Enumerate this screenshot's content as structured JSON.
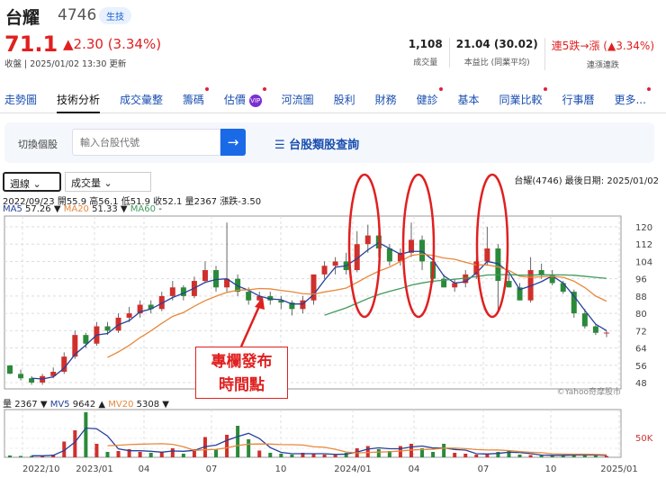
{
  "header": {
    "name": "台耀",
    "code": "4746",
    "tag": "生技",
    "price": "71.1",
    "change": "▲2.30 (3.34%)",
    "updated": "收盤 | 2025/01/02 13:30 更新"
  },
  "stats": [
    {
      "value": "1,108",
      "label": "成交量"
    },
    {
      "value": "21.04 (30.02)",
      "label": "本益比 (同業平均)"
    },
    {
      "value": "連5跌→漲 (▲3.34%)",
      "label": "連漲連跌"
    }
  ],
  "nav": [
    {
      "label": "走勢圖"
    },
    {
      "label": "技術分析",
      "active": true
    },
    {
      "label": "成交彙整"
    },
    {
      "label": "籌碼",
      "dot": true
    },
    {
      "label": "估價",
      "vip": "VIP",
      "dot": true
    },
    {
      "label": "河流圖"
    },
    {
      "label": "股利"
    },
    {
      "label": "財務"
    },
    {
      "label": "健診",
      "dot": true
    },
    {
      "label": "基本"
    },
    {
      "label": "同業比較",
      "dot": true
    },
    {
      "label": "行事曆"
    },
    {
      "label": "更多...",
      "dot": true
    }
  ],
  "search": {
    "label": "切換個股",
    "placeholder": "輸入台股代號",
    "arrow": "→",
    "category": "☰ 台股類股查詢"
  },
  "controls": {
    "period": "週線 ⌄",
    "indicator": "成交量 ⌄",
    "symbol": "台耀(4746)  最後日期: 2025/01/02"
  },
  "legend": {
    "ohlc": "2022/09/23 開55.9 高56.1 低51.9 收52.1 量2367 漲跌-3.50",
    "ma5": "MA5",
    "ma5v": "57.26 ▼",
    "ma20": "MA20",
    "ma20v": "51.33 ▼",
    "ma60": "MA60",
    "ma60v": "-",
    "vol": "量",
    "volv": "2367 ▼",
    "mv5": "MV5",
    "mv5v": "9642 ▲",
    "mv20": "MV20",
    "mv20v": "5308 ▼"
  },
  "annotation": {
    "line1": "專欄發布",
    "line2": "時間點"
  },
  "watermark": "©Yahoo奇摩股市",
  "colors": {
    "up": "#d0302c",
    "down": "#2a8a3a",
    "ma5": "#25409a",
    "ma20": "#e8883a",
    "ma60": "#3f9a5a",
    "accent": "#e02020"
  },
  "chart_data": {
    "type": "candlestick",
    "yticks": [
      120,
      112,
      104,
      96,
      88,
      80,
      72,
      64,
      56,
      48
    ],
    "ylim": [
      44,
      124
    ],
    "xticks": [
      "2022/10",
      "2023/01",
      "04",
      "07",
      "10",
      "2024/01",
      "04",
      "07",
      "10",
      "2025/01"
    ],
    "vol_tick": "50K",
    "candles": [
      [
        55.9,
        56.1,
        51.9,
        52.1,
        4
      ],
      [
        52,
        54,
        49,
        50,
        3
      ],
      [
        50,
        51,
        47,
        48,
        3
      ],
      [
        48,
        52,
        47,
        51,
        4
      ],
      [
        51,
        55,
        50,
        53,
        6
      ],
      [
        53,
        62,
        52,
        60,
        35
      ],
      [
        60,
        72,
        59,
        70,
        60
      ],
      [
        70,
        71,
        64,
        66,
        100
      ],
      [
        66,
        76,
        65,
        74,
        30
      ],
      [
        74,
        76,
        70,
        72,
        12
      ],
      [
        72,
        80,
        71,
        78,
        14
      ],
      [
        78,
        83,
        76,
        80,
        18
      ],
      [
        80,
        86,
        78,
        84,
        12
      ],
      [
        84,
        86,
        80,
        82,
        10
      ],
      [
        82,
        90,
        81,
        88,
        12
      ],
      [
        88,
        95,
        86,
        92,
        20
      ],
      [
        92,
        93,
        86,
        88,
        8
      ],
      [
        88,
        97,
        87,
        95,
        18
      ],
      [
        95,
        104,
        94,
        100,
        45
      ],
      [
        100,
        102,
        90,
        92,
        18
      ],
      [
        92,
        122,
        90,
        96,
        50
      ],
      [
        96,
        98,
        88,
        90,
        70
      ],
      [
        90,
        92,
        84,
        86,
        40
      ],
      [
        86,
        90,
        84,
        88,
        15
      ],
      [
        88,
        90,
        84,
        86,
        10
      ],
      [
        86,
        88,
        82,
        85,
        8
      ],
      [
        85,
        86,
        79,
        82,
        6
      ],
      [
        82,
        88,
        80,
        86,
        10
      ],
      [
        86,
        96,
        84,
        98,
        8
      ],
      [
        98,
        104,
        96,
        102,
        6
      ],
      [
        102,
        106,
        98,
        104,
        5
      ],
      [
        104,
        108,
        98,
        100,
        10
      ],
      [
        100,
        118,
        99,
        112,
        20
      ],
      [
        112,
        121,
        108,
        116,
        25
      ],
      [
        116,
        118,
        106,
        110,
        18
      ],
      [
        110,
        112,
        102,
        104,
        14
      ],
      [
        104,
        110,
        102,
        108,
        25
      ],
      [
        108,
        122,
        106,
        114,
        30
      ],
      [
        114,
        116,
        100,
        104,
        20
      ],
      [
        104,
        106,
        94,
        96,
        12
      ],
      [
        96,
        98,
        92,
        92,
        30
      ],
      [
        92,
        96,
        90,
        94,
        10
      ],
      [
        94,
        100,
        92,
        98,
        8
      ],
      [
        98,
        106,
        96,
        104,
        6
      ],
      [
        104,
        120,
        102,
        110,
        8
      ],
      [
        110,
        112,
        80,
        95,
        12
      ],
      [
        95,
        98,
        92,
        92,
        14
      ],
      [
        92,
        94,
        86,
        86,
        6
      ],
      [
        86,
        106,
        85,
        100,
        5
      ],
      [
        100,
        103,
        96,
        98,
        4
      ],
      [
        98,
        100,
        93,
        94,
        4
      ],
      [
        94,
        95,
        89,
        90,
        5
      ],
      [
        90,
        91,
        78,
        80,
        6
      ],
      [
        80,
        82,
        73,
        74,
        5
      ],
      [
        74,
        75,
        70,
        71,
        4
      ],
      [
        71,
        72,
        69,
        71.1,
        3
      ]
    ]
  }
}
